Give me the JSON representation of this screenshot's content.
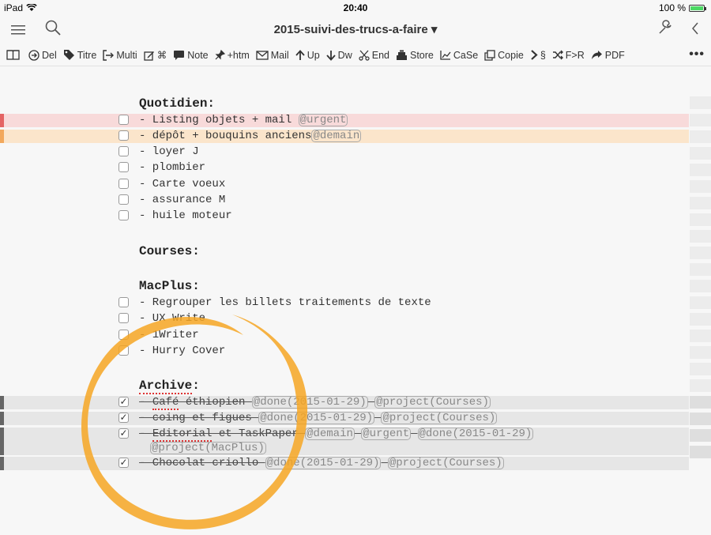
{
  "status_bar": {
    "device": "iPad",
    "time": "20:40",
    "battery": "100 %"
  },
  "title_bar": {
    "title": "2015-suivi-des-trucs-a-faire",
    "caret": "▾"
  },
  "toolbar": {
    "items": [
      {
        "label": "",
        "icon": "book-icon"
      },
      {
        "label": "Del",
        "icon": "circle-arrow-icon"
      },
      {
        "label": "Titre",
        "icon": "tag-icon"
      },
      {
        "label": "Multi",
        "icon": "enter-icon"
      },
      {
        "label": "⌘",
        "icon": "edit-icon"
      },
      {
        "label": "Note",
        "icon": "speech-bubble-icon"
      },
      {
        "label": "+htm",
        "icon": "pin-icon"
      },
      {
        "label": "Mail",
        "icon": "envelope-icon"
      },
      {
        "label": "Up",
        "icon": "arrow-up-icon"
      },
      {
        "label": "Dw",
        "icon": "arrow-down-icon"
      },
      {
        "label": "End",
        "icon": "scissors-icon"
      },
      {
        "label": "Store",
        "icon": "cash-register-icon"
      },
      {
        "label": "CaSe",
        "icon": "chart-icon"
      },
      {
        "label": "Copie",
        "icon": "copy-icon"
      },
      {
        "label": "§",
        "icon": "chevron-right-icon"
      },
      {
        "label": "F>R",
        "icon": "shuffle-icon"
      },
      {
        "label": "PDF",
        "icon": "share-arrow-icon"
      }
    ],
    "more": "•••"
  },
  "editor": {
    "h_quotidien": "Quotidien:",
    "q1": "- Listing objets + mail ",
    "q1_tag": "@urgent",
    "q2": "- dépôt + bouquins anciens",
    "q2_tag": "@demain",
    "q3": "- loyer J",
    "q4": "- plombier",
    "q5": "- Carte voeux",
    "q6": "- assurance M",
    "q7": "- huile moteur",
    "h_courses": "Courses:",
    "h_macplus": "MacPlus:",
    "m1": "- Regrouper les billets traitements de texte",
    "m2": "- UX Write",
    "m3": "- 1Writer",
    "m4": "- Hurry Cover",
    "h_archive_word": "Archive",
    "h_archive_colon": ":",
    "a1_dash": "- ",
    "a1_squig": "Café",
    "a1_rest": " éthiopien ",
    "a1_tag1": "@done(2015-01-29)",
    "a1_tag2": "@project(Courses)",
    "a2": "- coing et figues ",
    "a2_tag1": "@done(2015-01-29)",
    "a2_tag2": "@project(Courses)",
    "a3_dash": "- ",
    "a3_squig": "Editorial",
    "a3_rest": " et TaskPaper ",
    "a3_tag1": "@demain",
    "a3_tag2": "@urgent",
    "a3_tag3": "@done(2015-01-29)",
    "a3_tag4": "@project(MacPlus)",
    "a4": "- Chocolat criollo ",
    "a4_tag1": "@done(2015-01-29)",
    "a4_tag2": "@project(Courses)",
    "check": "✓"
  },
  "colors": {
    "urgent": "#e46464",
    "demain": "#f2a85c",
    "done": "#666666",
    "ring": "#f6a623"
  }
}
